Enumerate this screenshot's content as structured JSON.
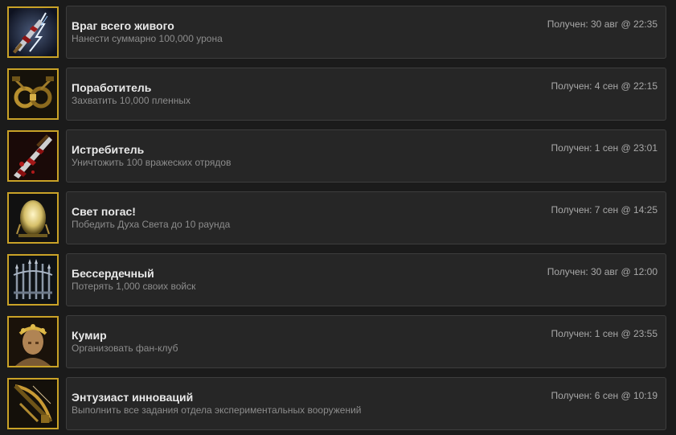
{
  "achievements": [
    {
      "icon": "blood-sword-lightning-icon",
      "title": "Враг всего живого",
      "description": "Нанести суммарно 100,000 урона",
      "unlocked": "Получен: 30 авг @ 22:35"
    },
    {
      "icon": "shackles-icon",
      "title": "Поработитель",
      "description": "Захватить 10,000 пленных",
      "unlocked": "Получен: 4 сен @ 22:15"
    },
    {
      "icon": "bloody-sword-icon",
      "title": "Истребитель",
      "description": "Уничтожить 100 вражеских отрядов",
      "unlocked": "Получен: 1 сен @ 23:01"
    },
    {
      "icon": "light-spirit-orb-icon",
      "title": "Свет погас!",
      "description": "Победить Духа Света до 10 раунда",
      "unlocked": "Получен: 7 сен @ 14:25"
    },
    {
      "icon": "iron-fence-icon",
      "title": "Бессердечный",
      "description": "Потерять 1,000 своих войск",
      "unlocked": "Получен: 30 авг @ 12:00"
    },
    {
      "icon": "laurel-bust-icon",
      "title": "Кумир",
      "description": "Организовать фан-клуб",
      "unlocked": "Получен: 1 сен @ 23:55"
    },
    {
      "icon": "crossbow-icon",
      "title": "Энтузиаст инноваций",
      "description": "Выполнить все задания отдела экспериментальных вооружений",
      "unlocked": "Получен: 6 сен @ 10:19"
    }
  ]
}
